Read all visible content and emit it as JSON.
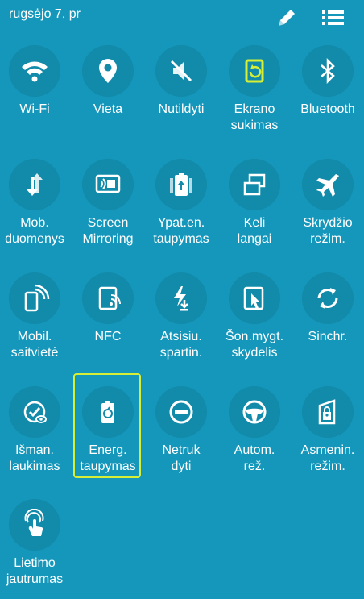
{
  "header": {
    "date": "rugsėjo 7, pr",
    "edit_icon": "pencil-icon",
    "list_icon": "list-icon"
  },
  "colors": {
    "background": "#1597bb",
    "tile_circle": "#128aa9",
    "active_icon": "#d6ef36",
    "selection_frame": "#d6ef36"
  },
  "tiles": [
    {
      "label": "Wi-Fi",
      "icon": "wifi-icon",
      "active": false
    },
    {
      "label": "Vieta",
      "icon": "location-pin-icon",
      "active": false
    },
    {
      "label": "Nutildyti",
      "icon": "mute-icon",
      "active": false
    },
    {
      "label": "Ekrano\nsukimas",
      "icon": "screen-rotation-icon",
      "active": true
    },
    {
      "label": "Bluetooth",
      "icon": "bluetooth-icon",
      "active": false
    },
    {
      "label": "Mob.\nduomenys",
      "icon": "mobile-data-icon",
      "active": false
    },
    {
      "label": "Screen\nMirroring",
      "icon": "screen-mirroring-icon",
      "active": false
    },
    {
      "label": "Ypat.en.\ntaupymas",
      "icon": "ultra-power-saving-icon",
      "active": false
    },
    {
      "label": "Keli\nlangai",
      "icon": "multi-window-icon",
      "active": false
    },
    {
      "label": "Skrydžio\nrežim.",
      "icon": "airplane-icon",
      "active": false
    },
    {
      "label": "Mobil.\nsaitvietė",
      "icon": "mobile-hotspot-icon",
      "active": false
    },
    {
      "label": "NFC",
      "icon": "nfc-icon",
      "active": false
    },
    {
      "label": "Atsisiu.\nspartin.",
      "icon": "download-booster-icon",
      "active": false
    },
    {
      "label": "Šon.mygt.\nskydelis",
      "icon": "side-key-panel-icon",
      "active": false
    },
    {
      "label": "Sinchr.",
      "icon": "sync-icon",
      "active": false
    },
    {
      "label": "Išman.\nlaukimas",
      "icon": "smart-stay-icon",
      "active": false
    },
    {
      "label": "Energ.\ntaupymas",
      "icon": "power-saving-icon",
      "active": false,
      "selected": true
    },
    {
      "label": "Netruk\ndyti",
      "icon": "do-not-disturb-icon",
      "active": false
    },
    {
      "label": "Autom.\nrež.",
      "icon": "driving-mode-icon",
      "active": false
    },
    {
      "label": "Asmenin.\nrežim.",
      "icon": "private-mode-icon",
      "active": false
    },
    {
      "label": "Lietimo\njautrumas",
      "icon": "touch-sensitivity-icon",
      "active": false
    }
  ]
}
